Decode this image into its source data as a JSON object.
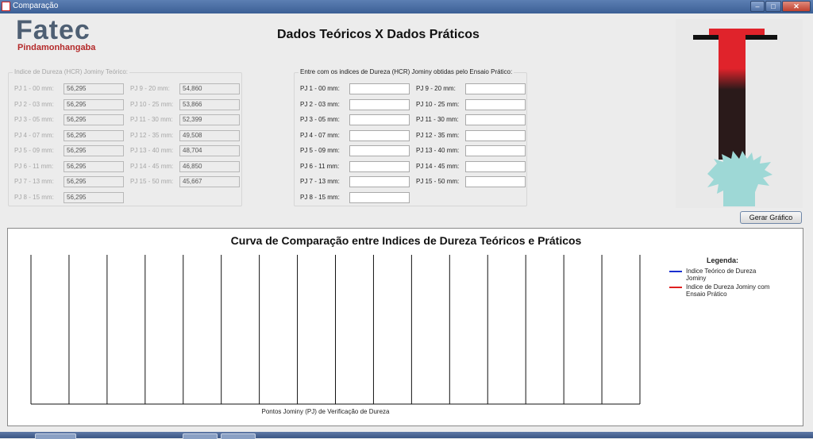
{
  "window": {
    "title": "Comparação",
    "min_glyph": "–",
    "max_glyph": "□",
    "close_glyph": "✕"
  },
  "logo": {
    "word": "Fatec",
    "subtitle": "Pindamonhangaba"
  },
  "main_title": "Dados Teóricos X Dados Práticos",
  "theoretical": {
    "legend": "Indice de Dureza (HCR) Jominy Teórico:",
    "fields": [
      {
        "label": "PJ 1 - 00 mm:",
        "value": "56,295"
      },
      {
        "label": "PJ 2 - 03 mm:",
        "value": "56,295"
      },
      {
        "label": "PJ 3 - 05 mm:",
        "value": "56,295"
      },
      {
        "label": "PJ 4 - 07 mm:",
        "value": "56,295"
      },
      {
        "label": "PJ 5 - 09 mm:",
        "value": "56,295"
      },
      {
        "label": "PJ 6 - 11 mm:",
        "value": "56,295"
      },
      {
        "label": "PJ 7 - 13 mm:",
        "value": "56,295"
      },
      {
        "label": "PJ 8 - 15 mm:",
        "value": "56,295"
      },
      {
        "label": "PJ 9 - 20 mm:",
        "value": "54,860"
      },
      {
        "label": "PJ 10 - 25 mm:",
        "value": "53,866"
      },
      {
        "label": "PJ 11 - 30 mm:",
        "value": "52,399"
      },
      {
        "label": "PJ 12 - 35 mm:",
        "value": "49,508"
      },
      {
        "label": "PJ 13 - 40 mm:",
        "value": "48,704"
      },
      {
        "label": "PJ 14 - 45 mm:",
        "value": "46,850"
      },
      {
        "label": "PJ 15 - 50 mm:",
        "value": "45,667"
      }
    ]
  },
  "practical": {
    "legend": "Entre com os indices de Dureza (HCR) Jominy obtidas pelo Ensaio Prático:",
    "fields": [
      {
        "label": "PJ 1 - 00 mm:",
        "value": ""
      },
      {
        "label": "PJ 2 - 03 mm:",
        "value": ""
      },
      {
        "label": "PJ 3 - 05 mm:",
        "value": ""
      },
      {
        "label": "PJ 4 - 07 mm:",
        "value": ""
      },
      {
        "label": "PJ 5 - 09 mm:",
        "value": ""
      },
      {
        "label": "PJ 6 - 11 mm:",
        "value": ""
      },
      {
        "label": "PJ 7 - 13 mm:",
        "value": ""
      },
      {
        "label": "PJ 8 - 15 mm:",
        "value": ""
      },
      {
        "label": "PJ 9 - 20 mm:",
        "value": ""
      },
      {
        "label": "PJ 10 - 25 mm:",
        "value": ""
      },
      {
        "label": "PJ 11 - 30 mm:",
        "value": ""
      },
      {
        "label": "PJ 12 - 35 mm:",
        "value": ""
      },
      {
        "label": "PJ 13 - 40 mm:",
        "value": ""
      },
      {
        "label": "PJ 14 - 45 mm:",
        "value": ""
      },
      {
        "label": "PJ 15 - 50 mm:",
        "value": ""
      }
    ]
  },
  "generate_button": "Gerar Gráfico",
  "chart": {
    "title": "Curva de Comparação entre Indices de Dureza Teóricos e Práticos",
    "legend_title": "Legenda:",
    "legend": [
      {
        "text": "Indice Teórico de Dureza Jominy",
        "color": "#1a2fd0"
      },
      {
        "text": "Indice de Dureza Jominy com Ensaio Prático",
        "color": "#e02020"
      }
    ],
    "xlabel": "Pontos Jominy (PJ) de Verificação de Dureza"
  },
  "colors": {
    "device_red": "#e0232b",
    "device_dark": "#2a1a1a",
    "device_water": "#9ed8d6"
  },
  "chart_data": {
    "type": "line",
    "title": "Curva de Comparação entre Indices de Dureza Teóricos e Práticos",
    "xlabel": "Pontos Jominy (PJ) de Verificação de Dureza",
    "ylabel": "",
    "categories_count": 16,
    "grid": "vertical",
    "legend_position": "right",
    "series": [
      {
        "name": "Indice Teórico de Dureza Jominy",
        "values": []
      },
      {
        "name": "Indice de Dureza Jominy com Ensaio Prático",
        "values": []
      }
    ]
  }
}
